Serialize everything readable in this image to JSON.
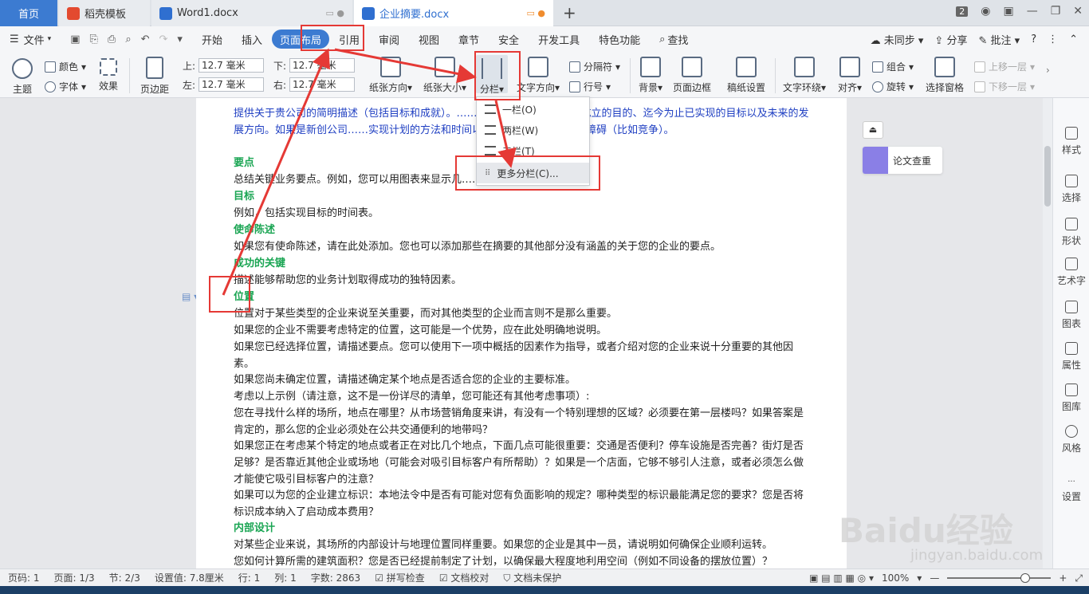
{
  "tabs": {
    "home": "首页",
    "t1": "稻壳模板",
    "t2": "Word1.docx",
    "t3": "企业摘要.docx",
    "badge": "2"
  },
  "menu": {
    "file": "文件",
    "items": [
      "开始",
      "插入",
      "页面布局",
      "引用",
      "审阅",
      "视图",
      "章节",
      "安全",
      "开发工具",
      "特色功能"
    ],
    "search": "查找",
    "sync": "未同步",
    "share": "分享",
    "annotate": "批注",
    "help": "?"
  },
  "ribbon": {
    "theme": "主题",
    "color": "颜色",
    "font": "字体",
    "effect": "效果",
    "margin": "页边距",
    "top_label": "上:",
    "top_val": "12.7 毫米",
    "bottom_label": "下:",
    "bottom_val": "12.7 毫米",
    "left_label": "左:",
    "left_val": "12.7 毫米",
    "right_label": "右:",
    "right_val": "12.7 毫米",
    "orientation": "纸张方向",
    "size": "纸张大小",
    "columns": "分栏",
    "text_direction": "文字方向",
    "breaks": "分隔符",
    "line_numbers": "行号",
    "background": "背景",
    "page_border": "页面边框",
    "manuscript": "稿纸设置",
    "text_wrap": "文字环绕",
    "align": "对齐",
    "group": "组合",
    "rotate": "旋转",
    "selection_pane": "选择窗格",
    "bring_forward": "上移一层",
    "send_backward": "下移一层"
  },
  "dropdown": {
    "one": "一栏(O)",
    "two": "两栏(W)",
    "three": "三栏(T)",
    "more": "更多分栏(C)..."
  },
  "doc": {
    "p1": "提供关于贵公司的简明描述（包括目标和成就）。…………，您可以介绍公司成立的目的、迄今为止已实现的目标以及未来的发展方向。如果是新创公司……实现计划的方法和时间以及您将如何克服主要的障碍（比如竞争）。",
    "h_points": "要点",
    "p_points": "总结关键业务要点。例如，您可以用图表来显示几……销售额、成本和利润。",
    "h_goal": "目标",
    "p_goal": "例如，包括实现目标的时间表。",
    "h_mission": "使命陈述",
    "p_mission": "如果您有使命陈述，请在此处添加。您也可以添加那些在摘要的其他部分没有涵盖的关于您的企业的要点。",
    "h_key": "成功的关键",
    "p_key": "描述能够帮助您的业务计划取得成功的独特因素。",
    "h_loc": "位置",
    "p_loc1": "位置对于某些类型的企业来说至关重要，而对其他类型的企业而言则不是那么重要。",
    "p_loc2": "如果您的企业不需要考虑特定的位置，这可能是一个优势，应在此处明确地说明。",
    "p_loc3": "如果您已经选择位置，请描述要点。您可以使用下一项中概括的因素作为指导，或者介绍对您的企业来说十分重要的其他因素。",
    "p_loc4": "如果您尚未确定位置，请描述确定某个地点是否适合您的企业的主要标准。",
    "p_loc5": "考虑以上示例（请注意，这不是一份详尽的清单，您可能还有其他考虑事项）:",
    "p_loc6": "您在寻找什么样的场所，地点在哪里？从市场营销角度来讲，有没有一个特别理想的区域？必须要在第一层楼吗？如果答案是肯定的，那么您的企业必须处在公共交通便利的地带吗？",
    "p_loc7": "如果您正在考虑某个特定的地点或者正在对比几个地点，下面几点可能很重要：交通是否便利？停车设施是否完善？街灯是否足够？是否靠近其他企业或场地（可能会对吸引目标客户有所帮助）？如果是一个店面，它够不够引人注意，或者必须怎么做才能使它吸引目标客户的注意？",
    "p_loc8": "如果可以为您的企业建立标识：本地法令中是否有可能对您有负面影响的规定？哪种类型的标识最能满足您的要求？您是否将标识成本纳入了启动成本费用？",
    "h_interior": "内部设计",
    "p_int1": "对某些企业来说，其场所的内部设计与地理位置同样重要。如果您的企业是其中一员，请说明如何确保企业顺利运转。",
    "p_int2": "您如何计算所需的建筑面积？您是否已经提前制定了计划，以确保最大程度地利用空间（例如不同设备的摆放位置）？"
  },
  "sidepanel": {
    "check": "论文查重",
    "items": [
      "样式",
      "选择",
      "形状",
      "艺术字",
      "图表",
      "属性",
      "图库",
      "风格",
      "设置"
    ]
  },
  "status": {
    "page": "页码: 1",
    "pages": "页面: 1/3",
    "section": "节: 2/3",
    "setting": "设置值: 7.8厘米",
    "row": "行: 1",
    "col": "列: 1",
    "words": "字数: 2863",
    "spell": "拼写检查",
    "proof": "文档校对",
    "protect": "文档未保护",
    "zoom": "100%"
  },
  "watermark": {
    "brand": "Baidu经验",
    "url": "jingyan.baidu.com"
  }
}
